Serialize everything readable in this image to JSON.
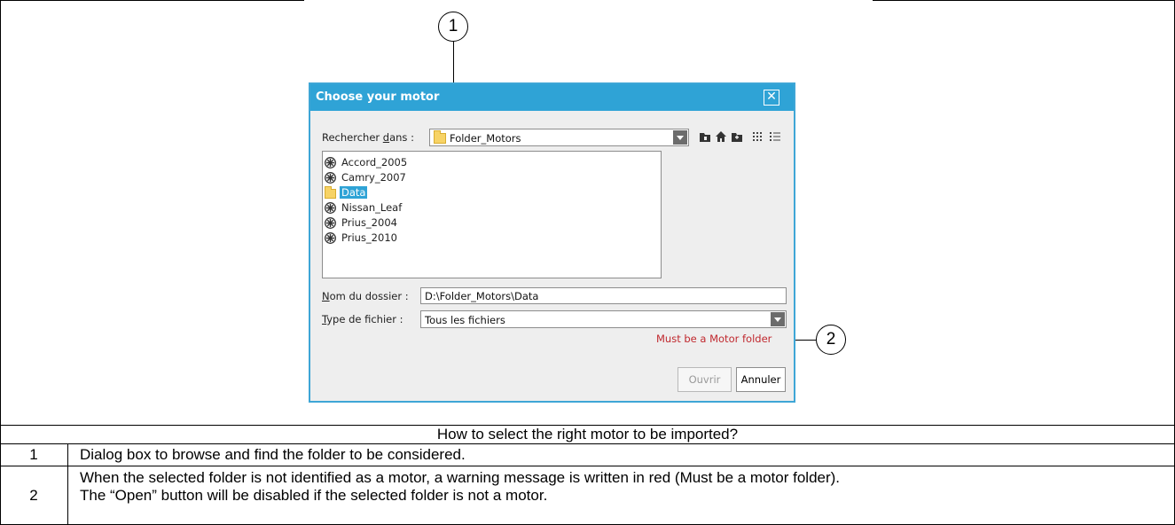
{
  "dialog": {
    "title": "Choose your motor",
    "look_in_label_pre": "Rechercher ",
    "look_in_label_mnemonic": "d",
    "look_in_label_post": "ans :",
    "look_in_value": "Folder_Motors",
    "toolbar_icons": [
      "up-folder-icon",
      "home-icon",
      "new-folder-icon",
      "list-view-icon",
      "details-view-icon"
    ],
    "files": [
      {
        "name": "Accord_2005",
        "icon": "motor-icon",
        "selected": false
      },
      {
        "name": "Camry_2007",
        "icon": "motor-icon",
        "selected": false
      },
      {
        "name": "Data",
        "icon": "folder-icon",
        "selected": true
      },
      {
        "name": "Nissan_Leaf",
        "icon": "motor-icon",
        "selected": false
      },
      {
        "name": "Prius_2004",
        "icon": "motor-icon",
        "selected": false
      },
      {
        "name": "Prius_2010",
        "icon": "motor-icon",
        "selected": false
      }
    ],
    "folder_name_label_mnemonic": "N",
    "folder_name_label_post": "om du dossier :",
    "folder_name_value": "D:\\Folder_Motors\\Data",
    "file_type_label_mnemonic": "T",
    "file_type_label_post": "ype de fichier :",
    "file_type_value": "Tous les fichiers",
    "warning": "Must be a Motor folder",
    "open_label": "Ouvrir",
    "cancel_label": "Annuler"
  },
  "callouts": {
    "one": "1",
    "two": "2"
  },
  "caption": {
    "title": "How to select the right motor to be imported?",
    "rows": [
      {
        "num": "1",
        "text": "Dialog box to browse and find the folder to be considered."
      },
      {
        "num": "2",
        "line1": "When the selected folder is not identified as a motor, a warning message is written in red (Must be a motor folder).",
        "line2": "The “Open” button will be disabled if the selected folder is not a motor."
      }
    ]
  },
  "colors": {
    "titlebar": "#2fa3d6",
    "warning": "#c0282e",
    "selection": "#2fa3d6"
  }
}
